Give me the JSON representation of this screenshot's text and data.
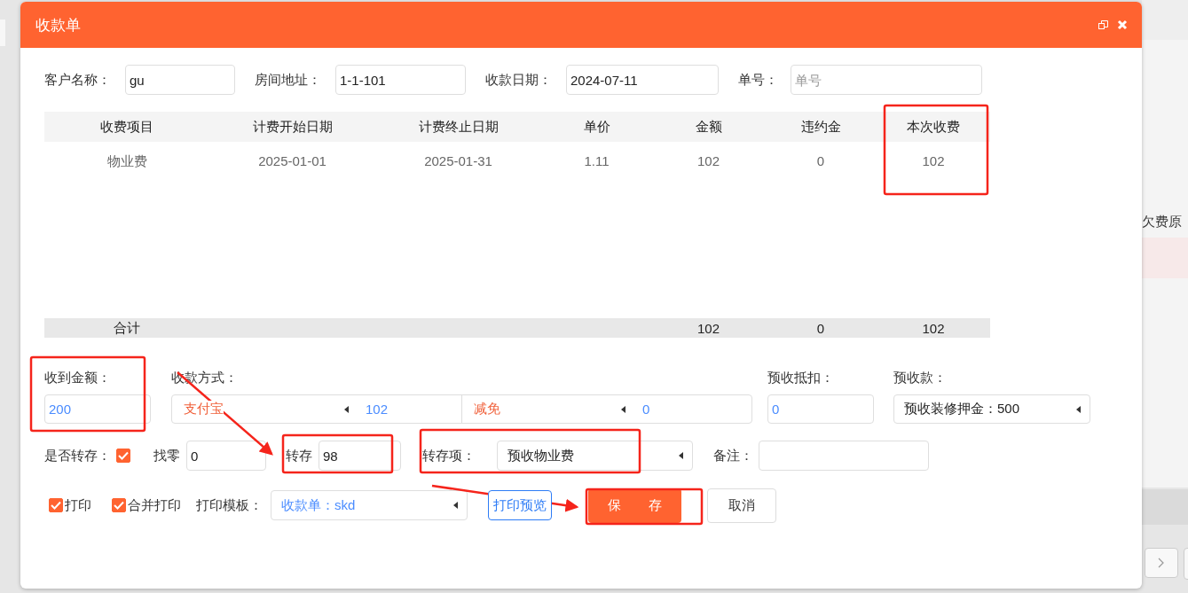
{
  "background": {
    "column_header": "欠费原"
  },
  "window": {
    "title": "收款单"
  },
  "header_fields": [
    {
      "label": "客户名称：",
      "value": "gu"
    },
    {
      "label": "房间地址：",
      "value": "1-1-101"
    },
    {
      "label": "收款日期：",
      "value": "2024-07-11"
    },
    {
      "label": "单号：",
      "placeholder": "单号"
    }
  ],
  "table": {
    "columns": [
      "收费项目",
      "计费开始日期",
      "计费终止日期",
      "单价",
      "金额",
      "违约金",
      "本次收费"
    ],
    "rows": [
      [
        "物业费",
        "2025-01-01",
        "2025-01-31",
        "1.11",
        "102",
        "0",
        "102"
      ]
    ],
    "total": {
      "label": "合计",
      "amount": "102",
      "penalty": "0",
      "this_charge": "102"
    }
  },
  "received": {
    "label": "收到金额：",
    "value": "200"
  },
  "payment": {
    "label": "收款方式：",
    "entries": [
      {
        "method": "支付宝",
        "amount": "102"
      },
      {
        "method": "减免",
        "amount": "0"
      }
    ]
  },
  "prepay_deduct": {
    "label": "预收抵扣：",
    "value": "0"
  },
  "prepay": {
    "label": "预收款：",
    "value": "预收装修押金：500"
  },
  "transfer": {
    "label": "是否转存：",
    "checked": true
  },
  "change": {
    "label": "找零",
    "value": "0"
  },
  "transfer_amount": {
    "label": "转存",
    "value": "98"
  },
  "transfer_item": {
    "label": "转存项：",
    "value": "预收物业费"
  },
  "remark": {
    "label": "备注："
  },
  "print_options": [
    {
      "label": "打印",
      "checked": true
    },
    {
      "label": "合并打印",
      "checked": true
    }
  ],
  "template": {
    "label": "打印模板：",
    "value": "收款单：skd"
  },
  "buttons": [
    {
      "label": "打印预览",
      "kind": "outline"
    },
    {
      "label": "保 存",
      "kind": "primary"
    },
    {
      "label": "取消",
      "kind": "default"
    }
  ]
}
